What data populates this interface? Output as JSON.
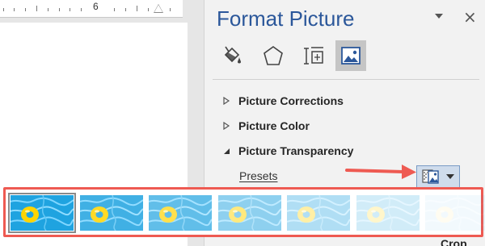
{
  "ruler": {
    "number": "6"
  },
  "pane": {
    "title": "Format Picture",
    "close_glyph": "×",
    "tabs": [
      {
        "name": "fill-line-icon"
      },
      {
        "name": "effects-icon"
      },
      {
        "name": "size-properties-icon"
      },
      {
        "name": "picture-icon",
        "selected": true
      }
    ],
    "sections": [
      {
        "label": "Picture Corrections",
        "expanded": false
      },
      {
        "label": "Picture Color",
        "expanded": false
      },
      {
        "label": "Picture Transparency",
        "expanded": true
      }
    ],
    "presets_label": "Presets",
    "peek_label": "Crop"
  },
  "gallery": {
    "transparency_presets": [
      0,
      0.15,
      0.3,
      0.5,
      0.65,
      0.8,
      0.95
    ],
    "selected_index": 0
  },
  "colors": {
    "accent": "#2b579a",
    "highlight_border": "#ee5a52",
    "annotation_arrow": "#ee5a52"
  }
}
